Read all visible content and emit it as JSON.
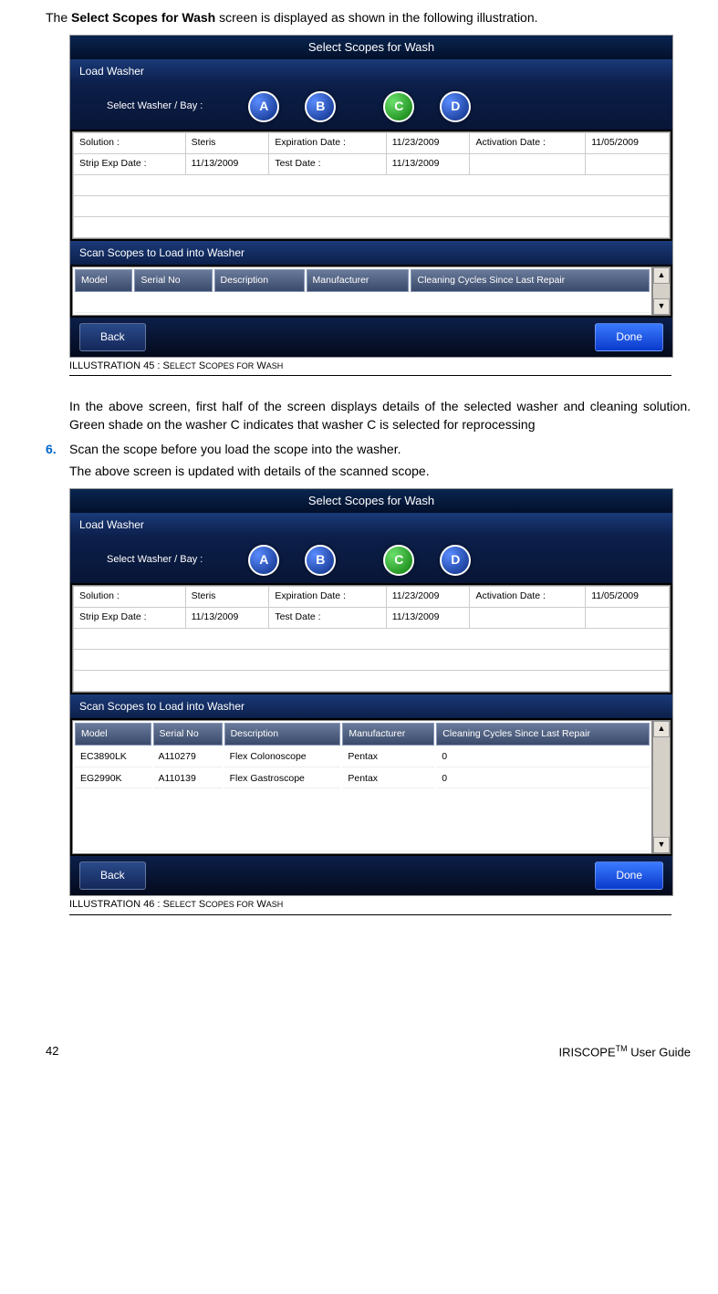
{
  "page": {
    "intro_pre": "The ",
    "intro_bold": "Select Scopes for Wash",
    "intro_post": " screen is displayed as shown in the following illustration.",
    "mid1": "In the above screen, first half of the screen displays details of the selected washer and cleaning solution. Green shade on the washer C indicates that washer C is selected for reprocessing",
    "step_num": "6.",
    "step_a": "Scan the scope before you load the scope into the washer.",
    "step_b": "The above screen is updated with details of the scanned scope.",
    "page_num": "42",
    "product": "IRISCOPE",
    "tm": "TM",
    "guide": " User Guide"
  },
  "caption45": "Illustration 45 : Select Scopes for Wash",
  "caption46": "Illustration 46 : Select Scopes for Wash",
  "app": {
    "title": "Select Scopes for Wash",
    "load": "Load Washer",
    "select_bay": "Select Washer / Bay :",
    "bays": {
      "a": "A",
      "b": "B",
      "c": "C",
      "d": "D"
    },
    "info": {
      "sol_l": "Solution :",
      "sol_v": "Steris",
      "exp_l": "Expiration Date :",
      "exp_v": "11/23/2009",
      "act_l": "Activation Date :",
      "act_v": "11/05/2009",
      "strip_l": "Strip Exp Date :",
      "strip_v": "11/13/2009",
      "test_l": "Test Date :",
      "test_v": "11/13/2009"
    },
    "scan": "Scan Scopes to Load into Washer",
    "cols": {
      "model": "Model",
      "serial": "Serial No",
      "desc": "Description",
      "manu": "Manufacturer",
      "cycles": "Cleaning Cycles Since Last Repair"
    },
    "rows": [
      {
        "model": "EC3890LK",
        "serial": "A110279",
        "desc": "Flex Colonoscope",
        "manu": "Pentax",
        "cycles": "0"
      },
      {
        "model": "EG2990K",
        "serial": "A110139",
        "desc": "Flex Gastroscope",
        "manu": "Pentax",
        "cycles": "0"
      }
    ],
    "back": "Back",
    "done": "Done",
    "up": "▲",
    "down": "▼"
  }
}
